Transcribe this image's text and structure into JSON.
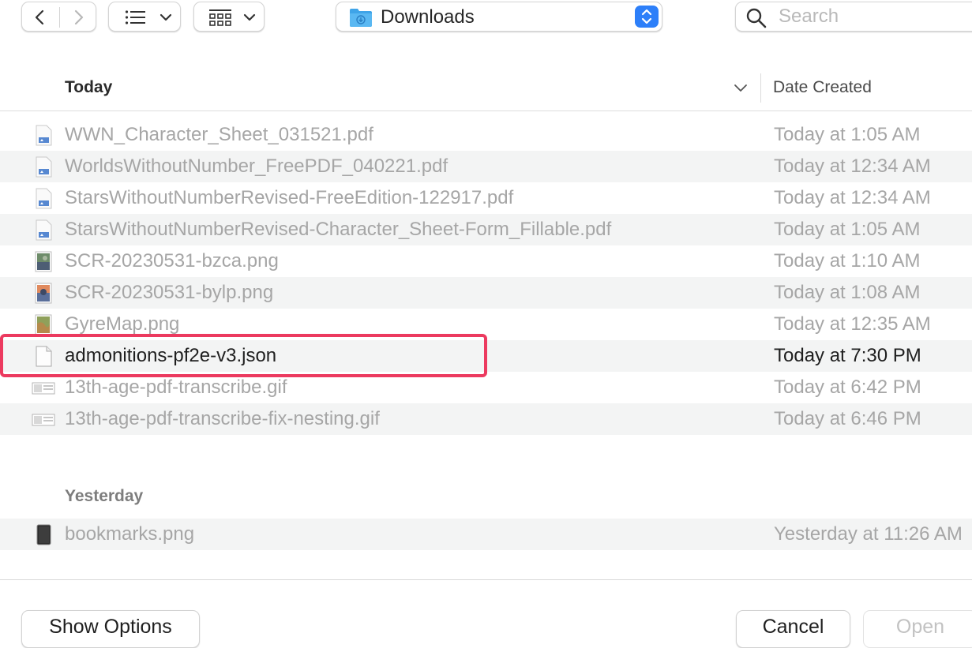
{
  "toolbar": {
    "back_icon": "chevron-left-icon",
    "forward_icon": "chevron-right-icon",
    "list_view_icon": "list-icon",
    "group_icon": "grid-icon",
    "path": {
      "label": "Downloads",
      "icon": "downloads-folder-icon"
    },
    "search": {
      "placeholder": "Search"
    }
  },
  "columns": {
    "name": "Today",
    "date": "Date Created"
  },
  "groups": [
    {
      "label": "Today",
      "files": [
        {
          "name": "WWN_Character_Sheet_031521.pdf",
          "date": "Today at 1:05 AM",
          "icon": "pdf-icon",
          "enabled": false
        },
        {
          "name": "WorldsWithoutNumber_FreePDF_040221.pdf",
          "date": "Today at 12:34 AM",
          "icon": "pdf-icon",
          "enabled": false
        },
        {
          "name": "StarsWithoutNumberRevised-FreeEdition-122917.pdf",
          "date": "Today at 12:34 AM",
          "icon": "pdf-icon",
          "enabled": false
        },
        {
          "name": "StarsWithoutNumberRevised-Character_Sheet-Form_Fillable.pdf",
          "date": "Today at 1:05 AM",
          "icon": "pdf-icon",
          "enabled": false
        },
        {
          "name": "SCR-20230531-bzca.png",
          "date": "Today at 1:10 AM",
          "icon": "image-icon",
          "enabled": false
        },
        {
          "name": "SCR-20230531-bylp.png",
          "date": "Today at 1:08 AM",
          "icon": "image-icon",
          "enabled": false
        },
        {
          "name": "GyreMap.png",
          "date": "Today at 12:35 AM",
          "icon": "map-image-icon",
          "enabled": false
        },
        {
          "name": "admonitions-pf2e-v3.json",
          "date": "Today at 7:30 PM",
          "icon": "json-file-icon",
          "enabled": true
        },
        {
          "name": "13th-age-pdf-transcribe.gif",
          "date": "Today at 6:42 PM",
          "icon": "gif-icon",
          "enabled": false
        },
        {
          "name": "13th-age-pdf-transcribe-fix-nesting.gif",
          "date": "Today at 6:46 PM",
          "icon": "gif-icon",
          "enabled": false
        }
      ]
    },
    {
      "label": "Yesterday",
      "files": [
        {
          "name": "bookmarks.png",
          "date": "Yesterday at 11:26 AM",
          "icon": "phone-screenshot-icon",
          "enabled": false
        }
      ]
    }
  ],
  "buttons": {
    "options": "Show Options",
    "cancel": "Cancel",
    "open": "Open"
  },
  "colors": {
    "accent": "#2d7ff9",
    "highlight": "#ec3a5f",
    "disabled_text": "#a6a6a6"
  }
}
